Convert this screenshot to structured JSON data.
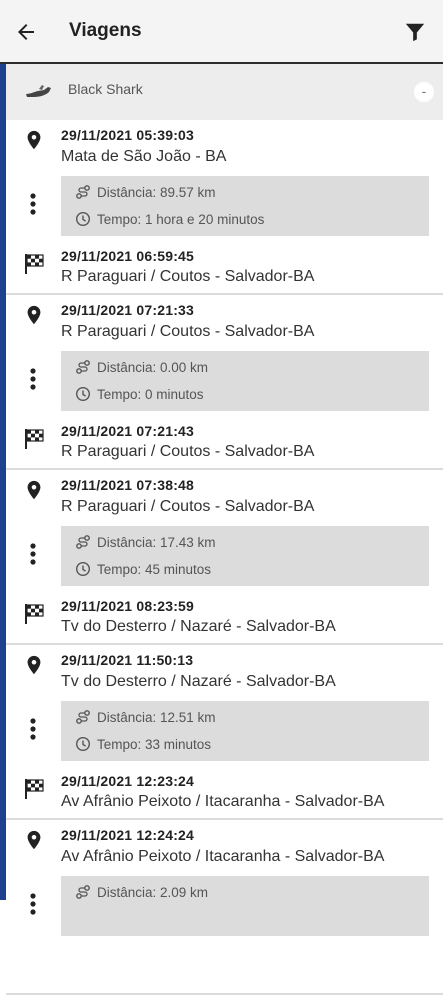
{
  "header": {
    "title": "Viagens",
    "back_icon": "arrow-left-icon",
    "filter_icon": "filter-icon"
  },
  "vehicle": {
    "name": "Black Shark",
    "icon": "jet-ski-icon",
    "collapse_label": "-"
  },
  "labels": {
    "distance_prefix": "Distância:",
    "time_prefix": "Tempo:"
  },
  "trips": [
    {
      "start_datetime": "29/11/2021 05:39:03",
      "start_address": "Mata de São João - BA",
      "distance": "Distância: 89.57 km",
      "duration": "Tempo: 1 hora e 20 minutos",
      "end_datetime": "29/11/2021 06:59:45",
      "end_address": "R Paraguari / Coutos - Salvador-BA"
    },
    {
      "start_datetime": "29/11/2021 07:21:33",
      "start_address": "R Paraguari / Coutos - Salvador-BA",
      "distance": "Distância: 0.00 km",
      "duration": "Tempo: 0 minutos",
      "end_datetime": "29/11/2021 07:21:43",
      "end_address": "R Paraguari / Coutos - Salvador-BA"
    },
    {
      "start_datetime": "29/11/2021 07:38:48",
      "start_address": "R Paraguari / Coutos - Salvador-BA",
      "distance": "Distância: 17.43 km",
      "duration": "Tempo: 45 minutos",
      "end_datetime": "29/11/2021 08:23:59",
      "end_address": "Tv do Desterro / Nazaré - Salvador-BA"
    },
    {
      "start_datetime": "29/11/2021 11:50:13",
      "start_address": "Tv do Desterro / Nazaré - Salvador-BA",
      "distance": "Distância: 12.51 km",
      "duration": "Tempo: 33 minutos",
      "end_datetime": "29/11/2021 12:23:24",
      "end_address": "Av Afrânio Peixoto / Itacaranha - Salvador-BA"
    },
    {
      "start_datetime": "29/11/2021 12:24:24",
      "start_address": "Av Afrânio Peixoto / Itacaranha - Salvador-BA",
      "distance": "Distância: 2.09 km",
      "duration": "",
      "end_datetime": "",
      "end_address": ""
    }
  ],
  "colors": {
    "accent_bar": "#1f3f8f",
    "app_bar_bg": "#f4f4f4",
    "stats_box_bg": "#dcdcdc"
  }
}
